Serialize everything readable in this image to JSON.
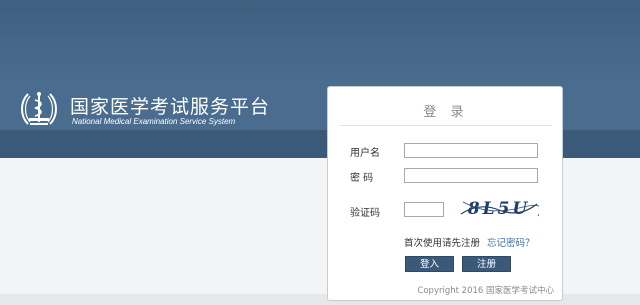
{
  "brand": {
    "title": "国家医学考试服务平台",
    "subtitle": "National Medical Examination Service System"
  },
  "login": {
    "title": "登 录",
    "username_label": "用户名",
    "username_value": "",
    "password_label": "密 码",
    "password_value": "",
    "captcha_label": "验证码",
    "captcha_value": "",
    "captcha_text": "8L5U",
    "first_time_hint": "首次使用请先注册",
    "forgot_password": "忘记密码？",
    "login_button": "登入",
    "register_button": "注册",
    "copyright": "Copyright 2016 国家医学考试中心"
  },
  "colors": {
    "banner": "#4a6d8f",
    "button": "#3b5a79",
    "link": "#3a6ea5"
  }
}
